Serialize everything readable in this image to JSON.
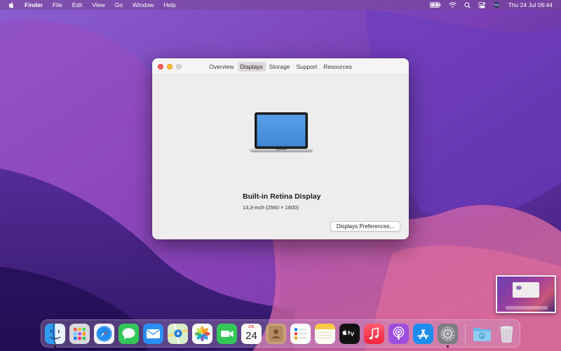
{
  "menubar": {
    "app_name": "Finder",
    "menus": [
      "File",
      "Edit",
      "View",
      "Go",
      "Window",
      "Help"
    ],
    "clock": "Thu 24 Jul  06:44"
  },
  "window": {
    "tabs": [
      "Overview",
      "Displays",
      "Storage",
      "Support",
      "Resources"
    ],
    "active_tab": "Displays",
    "display_name": "Built-in Retina Display",
    "display_spec": "13,3-inch (2560 × 1600)",
    "prefs_button": "Displays Preferences..."
  },
  "calendar": {
    "month": "JUL",
    "day": "24"
  },
  "dock": {
    "apps": [
      "finder-icon",
      "launchpad-icon",
      "safari-icon",
      "messages-icon",
      "mail-icon",
      "maps-icon",
      "photos-icon",
      "facetime-icon",
      "calendar-icon",
      "contacts-icon",
      "reminders-icon",
      "notes-icon",
      "apple-tv-icon",
      "music-icon",
      "podcasts-icon",
      "app-store-icon",
      "system-preferences-icon",
      "downloads-folder-icon",
      "trash-icon"
    ]
  },
  "colors": {
    "close": "#fe5f57",
    "minimize": "#febc2e",
    "zoom": "#d8d6d7",
    "wallpaper_top": "#7b4fc8",
    "wallpaper_bottom": "#2a1660"
  }
}
